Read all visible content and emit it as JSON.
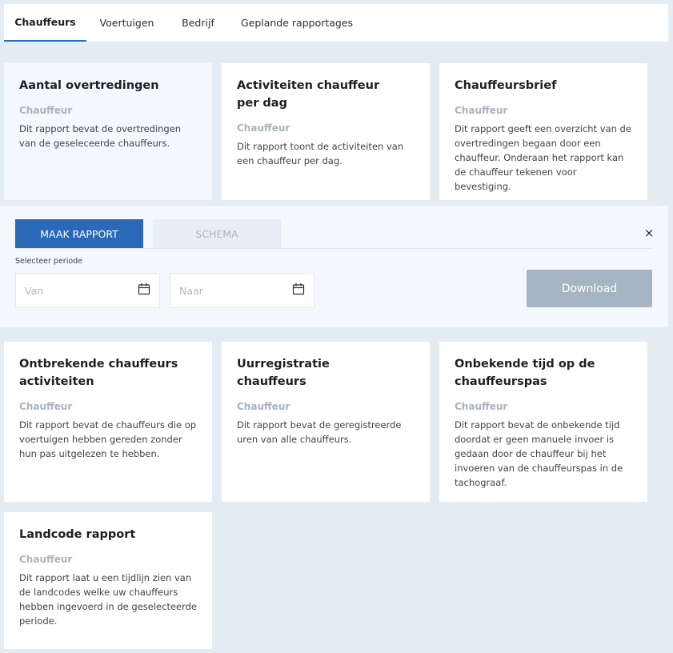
{
  "tabs": [
    {
      "label": "Chauffeurs",
      "active": true
    },
    {
      "label": "Voertuigen",
      "active": false
    },
    {
      "label": "Bedrijf",
      "active": false
    },
    {
      "label": "Geplande rapportages",
      "active": false
    }
  ],
  "cards": [
    {
      "title": "Aantal overtredingen",
      "category": "Chauffeur",
      "description": "Dit rapport bevat de overtredingen van de geseleceerde chauffeurs."
    },
    {
      "title": "Activiteiten chauffeur per dag",
      "category": "Chauffeur",
      "description": "Dit rapport toont de activiteiten van een chauffeur per dag."
    },
    {
      "title": "Chauffeursbrief",
      "category": "Chauffeur",
      "description": "Dit rapport geeft een overzicht van de overtredingen begaan door een chauffeur. Onderaan het rapport kan de chauffeur tekenen voor bevestiging."
    },
    {
      "title": "Ontbrekende chauffeurs activiteiten",
      "category": "Chauffeur",
      "description": "Dit rapport bevat de chauffeurs die op voertuigen hebben gereden zonder hun pas uitgelezen te hebben."
    },
    {
      "title": "Uurregistratie chauffeurs",
      "category": "Chauffeur",
      "description": "Dit rapport bevat de geregistreerde uren van alle chauffeurs."
    },
    {
      "title": "Onbekende tijd op de chauffeurspas",
      "category": "Chauffeur",
      "description": "Dit rapport bevat de onbekende tijd doordat er geen manuele invoer is gedaan door de chauffeur bij het invoeren van de chauffeurspas in de tachograaf."
    },
    {
      "title": "Landcode rapport",
      "category": "Chauffeur",
      "description": "Dit rapport laat u een tijdlijn zien van de landcodes welke uw chauffeurs hebben ingevoerd in de geselecteerde periode."
    }
  ],
  "panel": {
    "tab_make": "MAAK RAPPORT",
    "tab_schema": "SCHEMA",
    "close_symbol": "×",
    "period_label": "Selecteer periode",
    "from_placeholder": "Van",
    "to_placeholder": "Naar",
    "download_label": "Download"
  },
  "colors": {
    "accent": "#2a69b8",
    "background": "#e4ecf3",
    "disabled_button": "#a6b4c4",
    "category_text": "#a8b3c0"
  },
  "icons": {
    "date_picker": "calendar-icon",
    "close": "close-icon"
  }
}
